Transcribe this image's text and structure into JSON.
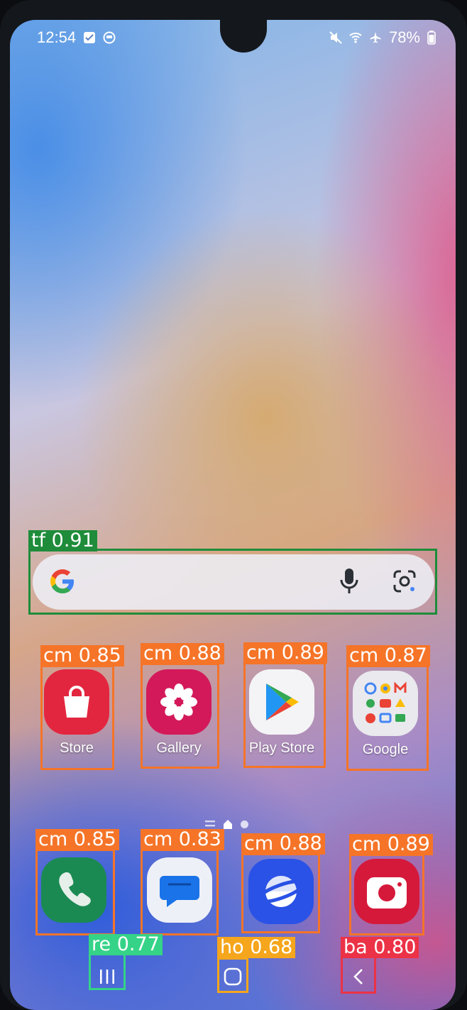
{
  "status_bar": {
    "time": "12:54",
    "battery": "78%",
    "left_icons": [
      "checkbox-notification-icon",
      "app-notification-icon"
    ],
    "right_icons": [
      "mute-icon",
      "wifi-icon",
      "airplane-icon",
      "battery-icon"
    ]
  },
  "search_bar": {
    "logo": "google-g-icon",
    "icons": [
      "microphone-icon",
      "google-lens-icon"
    ]
  },
  "apps_row1": [
    {
      "label": "Store",
      "icon": "store-bag-icon",
      "color": "#e3263f"
    },
    {
      "label": "Gallery",
      "icon": "gallery-flower-icon",
      "color": "#d3195a"
    },
    {
      "label": "Play Store",
      "icon": "play-store-icon",
      "color": "#f4f4f6"
    },
    {
      "label": "Google",
      "icon": "google-folder-icon",
      "color": "#e9e9ee"
    }
  ],
  "apps_row2": [
    {
      "label": "",
      "icon": "phone-icon",
      "color": "#1a8a52"
    },
    {
      "label": "",
      "icon": "messages-icon",
      "color": "#eef0f7"
    },
    {
      "label": "",
      "icon": "internet-browser-icon",
      "color": "#2a52e6"
    },
    {
      "label": "",
      "icon": "camera-icon",
      "color": "#d5193b"
    }
  ],
  "page_indicator": {
    "pages": 3,
    "current": 2
  },
  "nav_bar": {
    "buttons": [
      "recents-button",
      "home-button",
      "back-button"
    ]
  },
  "detections": [
    {
      "label": "tf 0.91",
      "color": "#1e8c3a"
    },
    {
      "label": "cm 0.85",
      "color": "#f57428"
    },
    {
      "label": "cm 0.88",
      "color": "#f57428"
    },
    {
      "label": "cm 0.89",
      "color": "#f57428"
    },
    {
      "label": "cm 0.87",
      "color": "#f57428"
    },
    {
      "label": "cm 0.85",
      "color": "#f57428"
    },
    {
      "label": "cm 0.83",
      "color": "#f57428"
    },
    {
      "label": "cm 0.88",
      "color": "#f57428"
    },
    {
      "label": "cm 0.89",
      "color": "#f57428"
    },
    {
      "label": "re 0.77",
      "color": "#35d387"
    },
    {
      "label": "ho 0.68",
      "color": "#f5a61c"
    },
    {
      "label": "ba 0.80",
      "color": "#ec3246"
    }
  ]
}
